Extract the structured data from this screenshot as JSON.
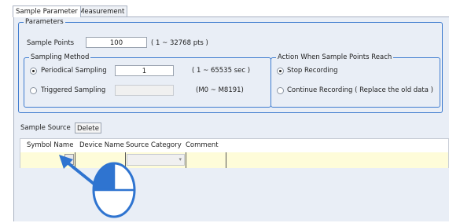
{
  "tabs": [
    {
      "label": "Sample Parameter",
      "active": true
    },
    {
      "label": "Measurement",
      "active": false
    }
  ],
  "parameters": {
    "legend": "Parameters",
    "sample_points_label": "Sample Points",
    "sample_points_value": "100",
    "sample_points_range": "( 1 ~ 32768 pts )"
  },
  "sampling_method": {
    "legend": "Sampling Method",
    "periodical_label": "Periodical Sampling",
    "periodical_value": "1",
    "periodical_range": "( 1 ~ 65535 sec )",
    "triggered_label": "Triggered Sampling",
    "triggered_value": "",
    "triggered_range": "(M0 ~ M8191)",
    "selected": "periodical"
  },
  "action": {
    "legend": "Action When Sample Points Reach",
    "stop_label": "Stop Recording",
    "continue_label": "Continue Recording ( Replace the old data )",
    "selected": "stop"
  },
  "sample_source": {
    "label": "Sample Source",
    "delete_label": "Delete"
  },
  "table": {
    "columns": [
      "Symbol Name",
      "Device Name",
      "Source Category",
      "Comment"
    ]
  },
  "colors": {
    "accent": "#2f74d0",
    "row_highlight": "#fefcd9",
    "panel_bg": "#e9eef6"
  },
  "icons": {
    "pointer": "arrow-pointer-icon",
    "mouse": "mouse-left-click-icon"
  }
}
